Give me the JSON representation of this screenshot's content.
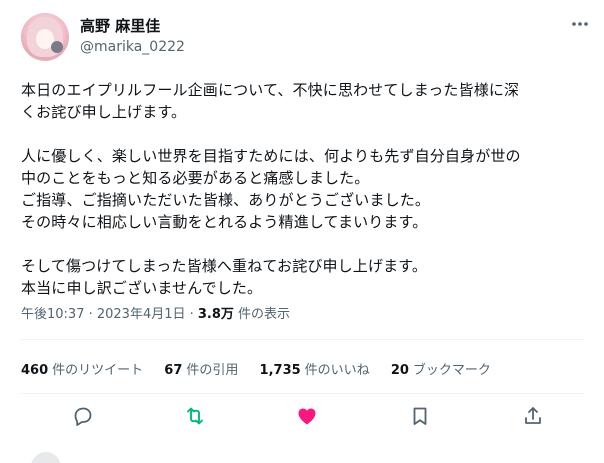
{
  "author": {
    "display_name": "高野 麻里佳",
    "handle": "@marika_0222",
    "avatar_icon": "avatar"
  },
  "tweet": {
    "lines": [
      "本日のエイプリルフール企画について、不快に思わせてしまった皆様に深",
      "くお詫び申し上げます。",
      "",
      "人に優しく、楽しい世界を目指すためには、何よりも先ず自分自身が世の",
      "中のことをもっと知る必要があると痛感しました。",
      "ご指導、ご指摘いただいた皆様、ありがとうございました。",
      "その時々に相応しい言動をとれるよう精進してまいります。",
      "",
      "そして傷つけてしまった皆様へ重ねてお詫び申し上げます。",
      "本当に申し訳ございませんでした。"
    ]
  },
  "meta": {
    "timestamp": "午後10:37 · 2023年4月1日 · ",
    "views_count": "3.8万",
    "views_label": " 件の表示"
  },
  "stats": [
    {
      "count": "460",
      "label": "件のリツイート"
    },
    {
      "count": "67",
      "label": "件の引用"
    },
    {
      "count": "1,735",
      "label": "件のいいね"
    },
    {
      "count": "20",
      "label": "ブックマーク"
    }
  ],
  "actions": {
    "reply_icon": "reply-icon",
    "retweet_icon": "retweet-icon",
    "like_icon": "heart-icon",
    "bookmark_icon": "bookmark-icon",
    "share_icon": "share-icon",
    "more_icon": "more-icon"
  },
  "colors": {
    "text": "#0f1419",
    "secondary": "#536471",
    "retweet": "#00ba7c",
    "like": "#f91880",
    "divider": "#eff3f4"
  }
}
